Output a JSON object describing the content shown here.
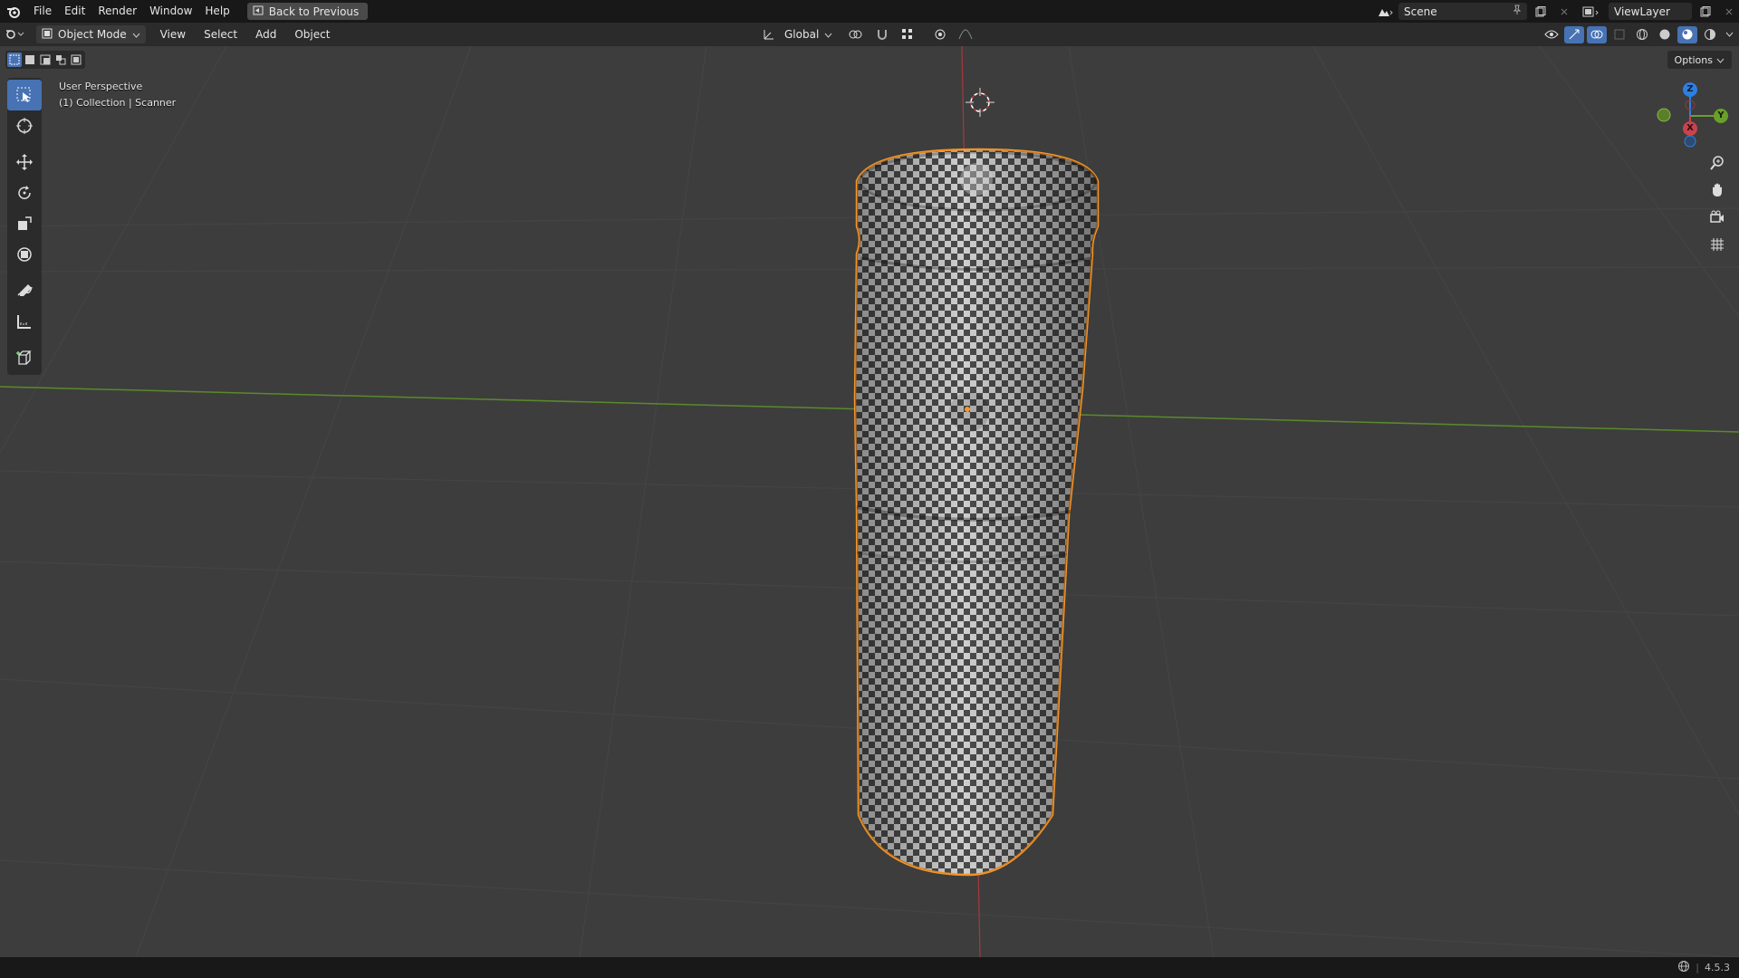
{
  "topbar": {
    "menus": [
      "File",
      "Edit",
      "Render",
      "Window",
      "Help"
    ],
    "back_button": "Back to Previous",
    "scene": "Scene",
    "view_layer": "ViewLayer"
  },
  "header": {
    "mode": "Object Mode",
    "menus": [
      "View",
      "Select",
      "Add",
      "Object"
    ],
    "orientation": "Global"
  },
  "viewport": {
    "perspective": "User Perspective",
    "collection": "(1) Collection | Scanner",
    "options": "Options"
  },
  "gizmo": {
    "z": "Z",
    "y": "Y",
    "x": "X"
  },
  "statusbar": {
    "version": "4.5.3"
  },
  "colors": {
    "selection": "#f7962a",
    "active_tool": "#4772b3",
    "x_axis": "#c8434b",
    "y_axis": "#6a9f2b",
    "z_axis": "#2f7fe0"
  },
  "icons": {
    "tools": [
      "select-box-icon",
      "cursor-icon",
      "move-icon",
      "rotate-icon",
      "scale-icon",
      "transform-icon",
      "annotate-icon",
      "measure-icon",
      "add-cube-icon"
    ]
  }
}
